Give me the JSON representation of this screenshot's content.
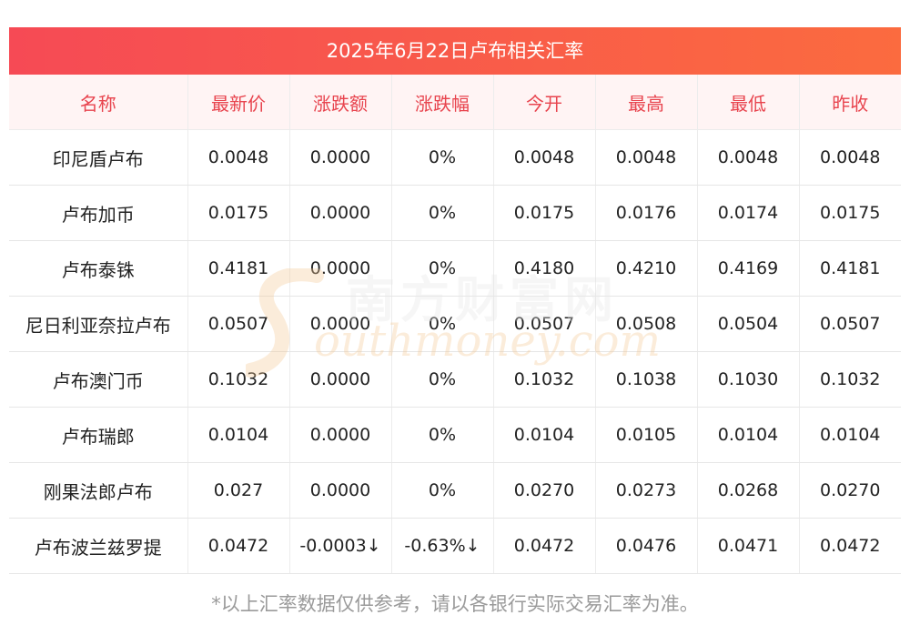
{
  "title": "2025年6月22日卢布相关汇率",
  "headers": [
    "名称",
    "最新价",
    "涨跌额",
    "涨跌幅",
    "今开",
    "最高",
    "最低",
    "昨收"
  ],
  "rows": [
    {
      "name": "印尼盾卢布",
      "latest": "0.0048",
      "change": "0.0000",
      "pct": "0%",
      "open": "0.0048",
      "high": "0.0048",
      "low": "0.0048",
      "prev": "0.0048",
      "trend": "flat"
    },
    {
      "name": "卢布加币",
      "latest": "0.0175",
      "change": "0.0000",
      "pct": "0%",
      "open": "0.0175",
      "high": "0.0176",
      "low": "0.0174",
      "prev": "0.0175",
      "trend": "flat"
    },
    {
      "name": "卢布泰铢",
      "latest": "0.4181",
      "change": "0.0000",
      "pct": "0%",
      "open": "0.4180",
      "high": "0.4210",
      "low": "0.4169",
      "prev": "0.4181",
      "trend": "flat"
    },
    {
      "name": "尼日利亚奈拉卢布",
      "latest": "0.0507",
      "change": "0.0000",
      "pct": "0%",
      "open": "0.0507",
      "high": "0.0508",
      "low": "0.0504",
      "prev": "0.0507",
      "trend": "flat"
    },
    {
      "name": "卢布澳门币",
      "latest": "0.1032",
      "change": "0.0000",
      "pct": "0%",
      "open": "0.1032",
      "high": "0.1038",
      "low": "0.1030",
      "prev": "0.1032",
      "trend": "flat"
    },
    {
      "name": "卢布瑞郎",
      "latest": "0.0104",
      "change": "0.0000",
      "pct": "0%",
      "open": "0.0104",
      "high": "0.0105",
      "low": "0.0104",
      "prev": "0.0104",
      "trend": "flat"
    },
    {
      "name": "刚果法郎卢布",
      "latest": "0.027",
      "change": "0.0000",
      "pct": "0%",
      "open": "0.0270",
      "high": "0.0273",
      "low": "0.0268",
      "prev": "0.0270",
      "trend": "flat"
    },
    {
      "name": "卢布波兰兹罗提",
      "latest": "0.0472",
      "change": "-0.0003↓",
      "pct": "-0.63%↓",
      "open": "0.0472",
      "high": "0.0476",
      "low": "0.0471",
      "prev": "0.0472",
      "trend": "down"
    }
  ],
  "footer": "*以上汇率数据仅供参考，请以各银行实际交易汇率为准。",
  "watermark": {
    "cn": "南方财富网",
    "en": "outhmoney.com"
  },
  "colors": {
    "title_start": "#f64a55",
    "title_end": "#fb6b3f",
    "header_text": "#e8444e",
    "down": "#1f8f1f"
  }
}
